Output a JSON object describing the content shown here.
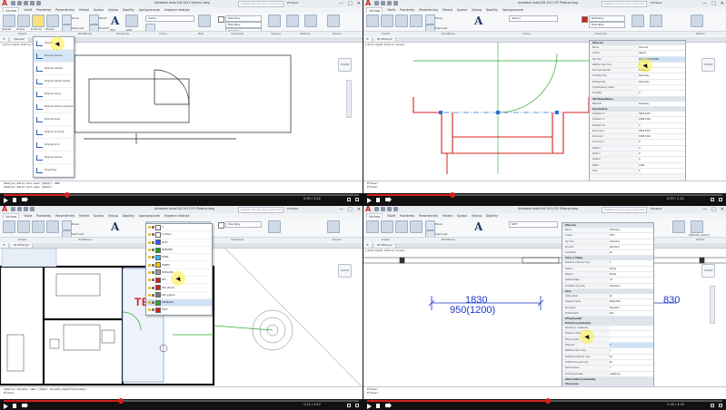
{
  "common": {
    "logo": "A",
    "window_controls": [
      "—",
      "□",
      "✕"
    ],
    "ribbon_tabs": [
      "Výchozí",
      "Vložit",
      "Poznámky",
      "Parametricky",
      "Pohled",
      "Správa",
      "Výstup",
      "Doplňky",
      "Spolupracovat",
      "Expresní nástroje",
      "Doporučené aplikace"
    ],
    "ribbon_labels": [
      "Úsečka",
      "Křivka",
      "Kružnice",
      "Oblouk",
      "Posun",
      "Otočit",
      "Kopírovat",
      "Zrcadlit",
      "Protáhnout",
      "Měřítko",
      "Text",
      "Kóta",
      "Vrstvy",
      "Vložit",
      "Vlastnosti",
      "Skupiny",
      "Nástroje",
      "Paleta",
      "Základní pohled"
    ],
    "panel_labels": [
      "Kreslit",
      "Modifikace",
      "Poznámky",
      "Vrstvy",
      "Blok",
      "Vlastnosti",
      "Skupiny",
      "Nástroje",
      "Pohled"
    ],
    "layer_value": "Vrstva",
    "bylayer": "DleVrstvy",
    "viewlabel": "[-][Horní][2D drátový model]",
    "search_placeholder": "Zadejte klíčové slovo nebo frázi",
    "user": "Přihlásit",
    "nav_cube_label": "HORNÍ",
    "colors": {
      "accent": "#d42020",
      "wall": "#d42020",
      "dim": "#1a35c9",
      "highlight": "#ffec3c"
    }
  },
  "q1": {
    "title": "Autodesk AutoCAD 2021  Výkres1.dwg",
    "doc_tab": "Výkres1*",
    "dropdown": [
      "Úsečka",
      "Polyline oblouk",
      "Polyline úsečka",
      "Polyline šikmá úsečka",
      "Polyline obrys",
      "Polyline oblouk polyobloukem",
      "Polyline body",
      "Polyline kruhová",
      "Polyline kruh",
      "Polyline oblouk",
      "Polykřivka"
    ],
    "dropdown_highlight": 1,
    "cmd": [
      "Zadejte další bod nebo [Zpět]: 900",
      "Zadejte další bod nebo [Zpět]:",
      "Příkaz:"
    ],
    "time": "0:39 / 3:52",
    "progress": 0.18
  },
  "q2": {
    "title": "Autodesk AutoCAD 2021  DF Půdorys.dwg",
    "doc_tab": "DF Půdorys*",
    "combo_layer": "Okenní",
    "props_title": "Obecné",
    "props": [
      [
        "Barva",
        "Červená"
      ],
      [
        "Vrstva",
        "Okenní"
      ],
      [
        "Typ čáry",
        "ACAD_ISO10W100"
      ],
      [
        "Měřítko typu čáry",
        "1"
      ],
      [
        "Styl vykreslování",
        "DleBarvy"
      ],
      [
        "Tloušťka čáry",
        "DleVrstvy"
      ],
      [
        "Průhlednost",
        "DleVrstvy"
      ],
      [
        "Hypertextový odkaz",
        ""
      ],
      [
        "Tloušťka",
        "0"
      ]
    ],
    "props_3d": "3D Vizualizace",
    "props_3d_rows": [
      [
        "Materiál",
        "DleVrstvy"
      ]
    ],
    "props_geo": "Geometrie",
    "props_geo_rows": [
      [
        "Počáteční X",
        "3944.0137"
      ],
      [
        "Počáteční Y",
        "1988.7242"
      ],
      [
        "Počáteční Z",
        "0"
      ],
      [
        "Koncové X",
        "3944.0137"
      ],
      [
        "Koncové Y",
        "1988.7242"
      ],
      [
        "Koncové Z",
        "0"
      ],
      [
        "Delta X",
        "0"
      ],
      [
        "Delta Y",
        "0"
      ],
      [
        "Delta Z",
        "0"
      ],
      [
        "Délka",
        "1200"
      ],
      [
        "Úhel",
        "0"
      ]
    ],
    "cmd": [
      "Příkaz:",
      "Příkaz:"
    ],
    "time": "0:39 / 2:41",
    "progress": 0.24
  },
  "q3": {
    "title": "Autodesk AutoCAD 2021  DF Půdorys.dwg",
    "doc_tab": "DF Půdorys*",
    "layers": [
      "0",
      "0_hlavní",
      "KÓTY",
      "NÁBYTEK",
      "OKNA",
      "POPISY",
      "PODLAHA",
      "ZDI",
      "ZDI_obvod",
      "ZDI_výplně",
      "ZAHRADA",
      "TEXT"
    ],
    "layer_colors": [
      "#ffffff",
      "#ffffff",
      "#2f52ff",
      "#19a319",
      "#2fb6ff",
      "#f2c400",
      "#9a9a9a",
      "#d42020",
      "#d42020",
      "#7a7a7a",
      "#2fa82f",
      "#d42020"
    ],
    "layer_highlight": 10,
    "big_text": "TEXT",
    "cmd": [
      "Vyberte objekty nebo [Výběr objektu/Zpět/Výsledek]:",
      "Příkaz:"
    ],
    "time": "1:12 / 4:57",
    "progress": 0.33
  },
  "q4": {
    "title": "Autodesk AutoCAD 2021  DF Půdorys.dwg",
    "doc_tab": "DF Půdorys*",
    "dim_main": "1830",
    "dim_sub": "950(1200)",
    "dim_right": "830",
    "sections": [
      "Obecné",
      "Čáry a šipky",
      "Text",
      "Přizpůsobit",
      "Primární jednotky",
      "Alternativní jednotky",
      "Tolerance"
    ],
    "props_top": [
      [
        "Barva",
        "DleVrstvy"
      ],
      [
        "Vrstva",
        "KÓTY"
      ],
      [
        "Typ čáry",
        "DleVrstvy"
      ],
      [
        "Styl kót",
        "Standard"
      ],
      [
        "Anotativní",
        "Ne"
      ]
    ],
    "props_mid": [
      [
        "Rozšíření kótovací čáry",
        "0"
      ],
      [
        "Šipka 1",
        "Šikmá"
      ],
      [
        "Šipka 2",
        "Šikmá"
      ],
      [
        "Velikost šipky",
        "2.5"
      ],
      [
        "Tloušťka čáry kóty",
        "DleVrstvy"
      ],
      [
        "Výška textu",
        "40"
      ],
      [
        "Přepsání textu",
        "950(1200)"
      ],
      [
        "Styl textu",
        "Standard"
      ],
      [
        "Poloha textu",
        "Nad"
      ]
    ],
    "props_prim": [
      [
        "Desetinný oddělovač",
        "."
      ],
      [
        "Předpona kóty",
        ""
      ],
      [
        "Přípona kóty",
        ""
      ],
      [
        "Přesnost",
        "0"
      ],
      [
        "Měřítko měřicí kóty",
        "1"
      ],
      [
        "Potlačit počáteční nuly",
        "Ne"
      ],
      [
        "Potlačit koncové nuly",
        "Ne"
      ],
      [
        "Zaokrouhlení",
        "0"
      ],
      [
        "Formát jednotek",
        "Desetinné"
      ]
    ],
    "props_prim_highlight": 3,
    "cmd": [
      "Příkaz:",
      "Příkaz:"
    ],
    "time": "2:18 / 4:30",
    "progress": 0.51
  }
}
